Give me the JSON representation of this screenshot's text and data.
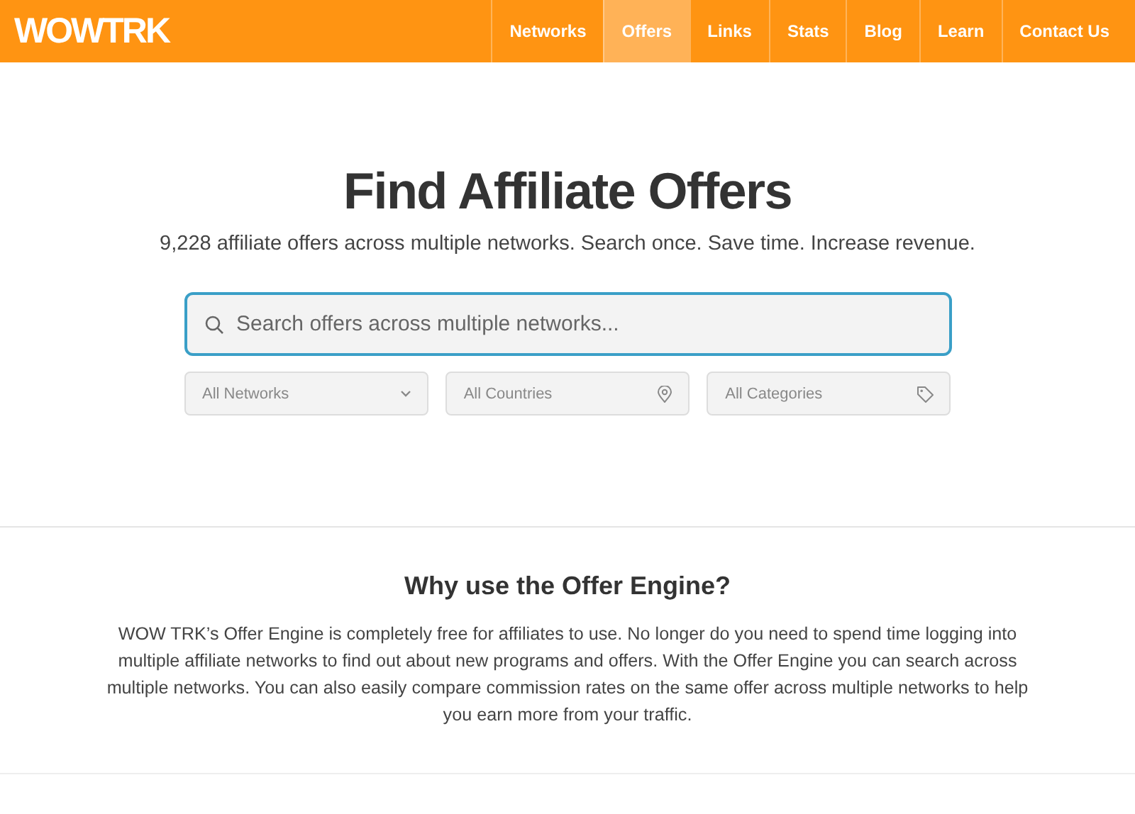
{
  "header": {
    "logo": "WOWTRK",
    "nav": [
      {
        "label": "Networks",
        "selected": false
      },
      {
        "label": "Offers",
        "selected": true
      },
      {
        "label": "Links",
        "selected": false
      },
      {
        "label": "Stats",
        "selected": false
      },
      {
        "label": "Blog",
        "selected": false
      },
      {
        "label": "Learn",
        "selected": false
      },
      {
        "label": "Contact Us",
        "selected": false
      }
    ]
  },
  "hero": {
    "title": "Find Affiliate Offers",
    "subtitle": "9,228 affiliate offers across multiple networks. Search once. Save time. Increase revenue.",
    "search": {
      "placeholder": "Search offers across multiple networks..."
    },
    "filters": [
      {
        "placeholder": "All Networks",
        "kind": "dropdown"
      },
      {
        "placeholder": "All Countries",
        "kind": "location"
      },
      {
        "placeholder": "All Categories",
        "kind": "tag"
      }
    ]
  },
  "why": {
    "title": "Why use the Offer Engine?",
    "text": "WOW TRK’s Offer Engine is completely free for affiliates to use. No longer do you need to spend time logging into multiple affiliate networks to find out about new programs and offers. With the Offer Engine you can search across multiple networks. You can also easily compare commission rates on the same offer across multiple networks to help you earn more from your traffic."
  }
}
